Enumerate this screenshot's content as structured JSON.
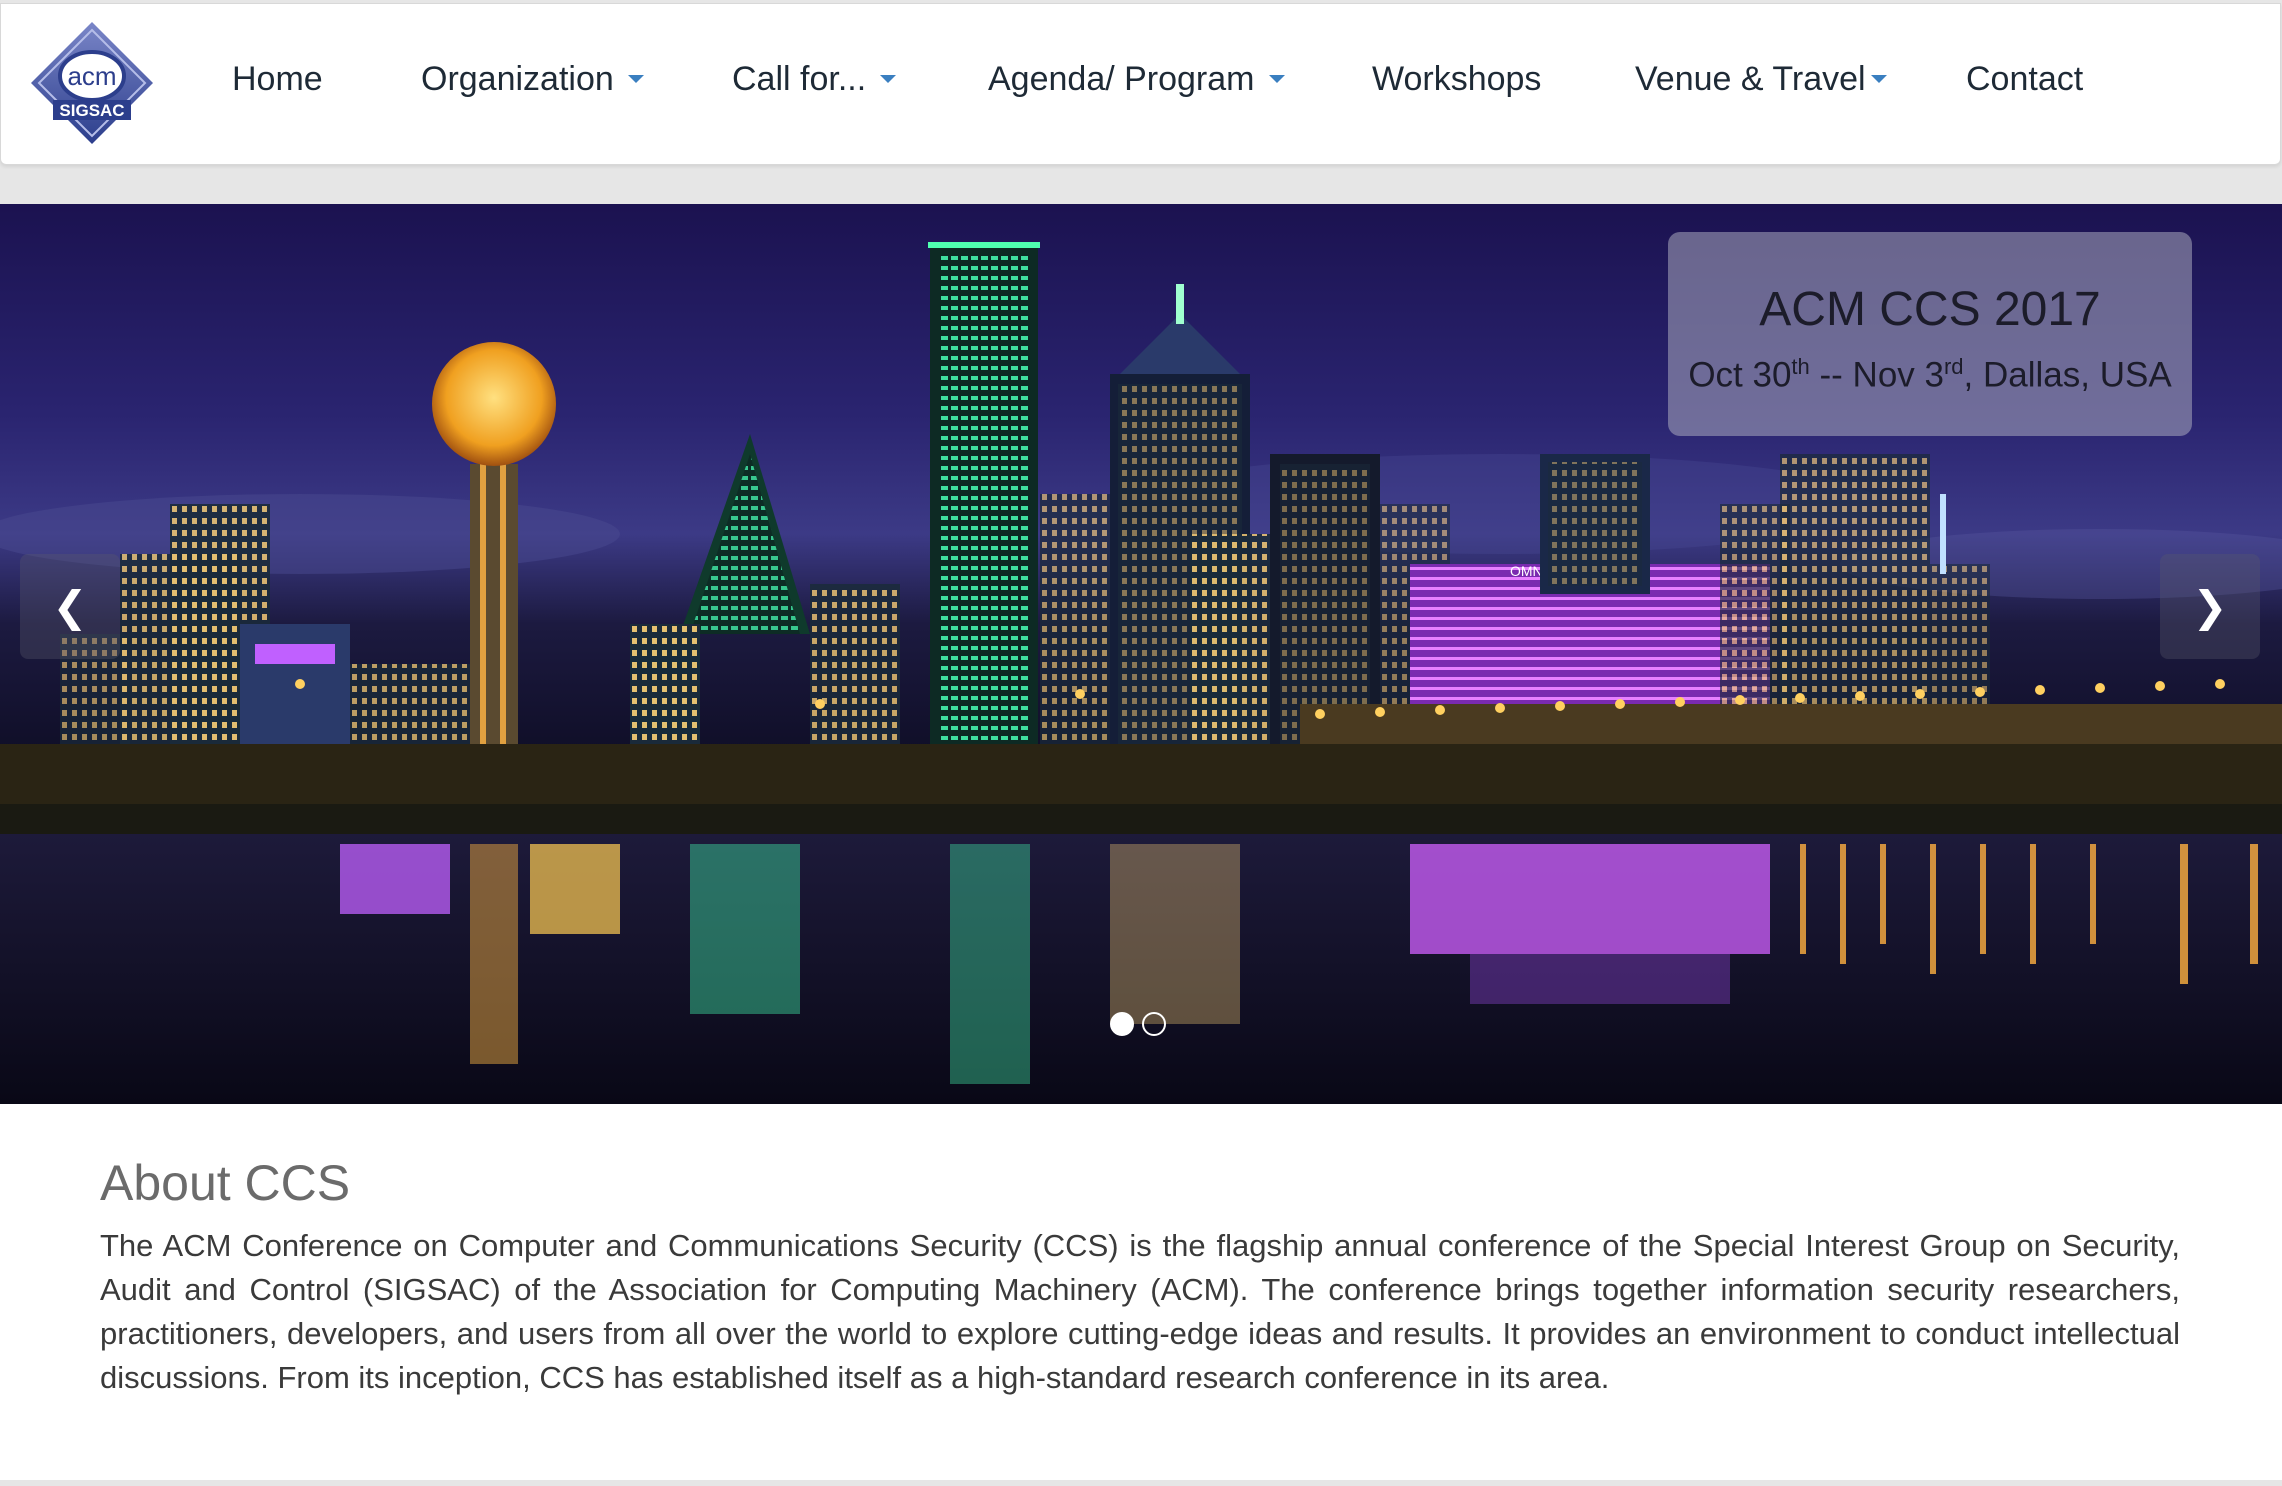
{
  "logo": {
    "top_text": "acm",
    "bottom_text": "SIGSAC"
  },
  "nav": {
    "items": [
      {
        "label": "Home",
        "dropdown": false
      },
      {
        "label": "Organization",
        "dropdown": true
      },
      {
        "label": "Call for...",
        "dropdown": true
      },
      {
        "label": "Agenda/ Program",
        "dropdown": true
      },
      {
        "label": "Workshops",
        "dropdown": false
      },
      {
        "label": "Venue & Travel",
        "dropdown": true
      },
      {
        "label": "Contact",
        "dropdown": false
      }
    ]
  },
  "hero": {
    "title": "ACM CCS 2017",
    "date_start": "Oct 30",
    "date_start_suffix": "th",
    "separator": " -- Nov 3",
    "date_end_suffix": "rd",
    "location": ", Dallas, USA",
    "prev_icon": "chevron-left-icon",
    "next_icon": "chevron-right-icon",
    "slide_count": 2,
    "active_slide": 1
  },
  "about": {
    "heading": "About CCS",
    "body": "The ACM Conference on Computer and Communications Security (CCS) is the flagship annual conference of the Special Interest Group on Security, Audit and Control (SIGSAC) of the Association for Computing Machinery (ACM). The conference brings together information security researchers, practitioners, developers, and users from all over the world to explore cutting-edge ideas and results. It provides an environment to conduct intellectual discussions. From its inception, CCS has established itself as a high-standard research conference in its area."
  },
  "colors": {
    "nav_text": "#1e2a36",
    "caret": "#3a7fc0",
    "sky": "#1a1550",
    "logo_blue": "#2c3e8c"
  }
}
